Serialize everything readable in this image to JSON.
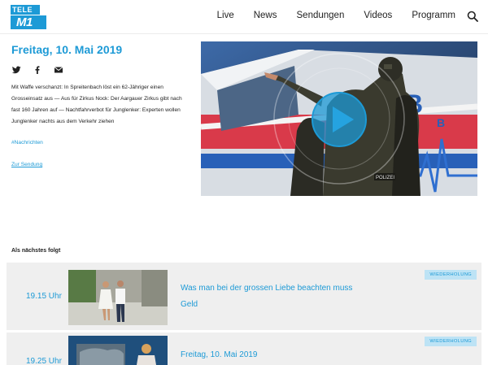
{
  "header": {
    "logo_top": "TELE",
    "logo_bottom": "M1",
    "nav": [
      "Live",
      "News",
      "Sendungen",
      "Videos",
      "Programm"
    ]
  },
  "article": {
    "date": "Freitag, 10. Mai 2019",
    "teaser": "Mit Waffe verschanzt: In Spreitenbach löst ein 62-Jähriger einen Grosseinsatz aus — Aus für Zirkus Nock: Der Aargauer Zirkus gibt nach fast 160 Jahren auf — Nachtfahrverbot für Junglenker: Experten wollen Junglenker nachts aus dem Verkehr ziehen",
    "hashtag": "#Nachrichten",
    "zur_sendung": "Zur Sendung",
    "social_icons": [
      "twitter-icon",
      "facebook-icon",
      "mail-icon"
    ]
  },
  "video": {
    "icon": "play-icon",
    "vehicle_letters": "B",
    "vehicle_letters_2": "B",
    "police_patch": "POLIZEI"
  },
  "schedule": {
    "heading": "Als nächstes folgt",
    "items": [
      {
        "time": "19.15 Uhr",
        "title": "Was man bei der grossen Liebe beachten muss",
        "subtitle": "Geld",
        "badge": "WIEDERHOLUNG"
      },
      {
        "time": "19.25 Uhr",
        "title": "Freitag, 10. Mai 2019",
        "badge": "WIEDERHOLUNG"
      }
    ]
  },
  "colors": {
    "accent": "#1d9ad6",
    "row_bg": "#efefef",
    "badge_bg": "#bde3f5"
  }
}
